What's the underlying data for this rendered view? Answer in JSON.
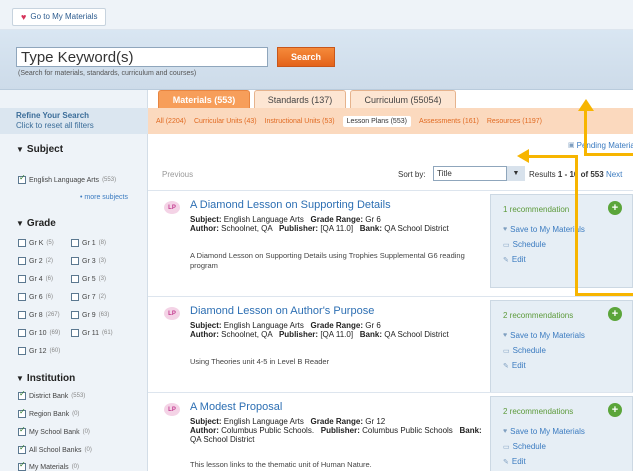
{
  "top": {
    "go_label": "Go to My Materials"
  },
  "search": {
    "value": "Type Keyword(s)",
    "button": "Search",
    "hint": "(Search for materials, standards, curriculum and courses)"
  },
  "refine": {
    "title": "Refine Your Search",
    "reset": "Click to reset all filters"
  },
  "tabs": [
    {
      "label": "Materials (553)"
    },
    {
      "label": "Standards (137)"
    },
    {
      "label": "Curriculum (55054)"
    }
  ],
  "subnav": [
    {
      "label": "All (2204)"
    },
    {
      "label": "Curricular Units (43)"
    },
    {
      "label": "Instructional Units (53)"
    },
    {
      "label": "Lesson Plans (553)"
    },
    {
      "label": "Assessments (161)"
    },
    {
      "label": "Resources (1197)"
    }
  ],
  "facets": {
    "subject": {
      "title": "Subject",
      "items": [
        {
          "label": "English Language Arts",
          "count": "(553)"
        }
      ],
      "more": "• more subjects"
    },
    "grade": {
      "title": "Grade",
      "items": [
        {
          "label": "Gr K",
          "count": "(5)"
        },
        {
          "label": "Gr 1",
          "count": "(8)"
        },
        {
          "label": "Gr 2",
          "count": "(2)"
        },
        {
          "label": "Gr 3",
          "count": "(3)"
        },
        {
          "label": "Gr 4",
          "count": "(6)"
        },
        {
          "label": "Gr 5",
          "count": "(3)"
        },
        {
          "label": "Gr 6",
          "count": "(6)"
        },
        {
          "label": "Gr 7",
          "count": "(2)"
        },
        {
          "label": "Gr 8",
          "count": "(267)"
        },
        {
          "label": "Gr 9",
          "count": "(63)"
        },
        {
          "label": "Gr 10",
          "count": "(69)"
        },
        {
          "label": "Gr 11",
          "count": "(61)"
        },
        {
          "label": "Gr 12",
          "count": "(60)"
        }
      ]
    },
    "institution": {
      "title": "Institution",
      "items": [
        {
          "label": "District Bank",
          "count": "(553)"
        },
        {
          "label": "Region Bank",
          "count": "(0)"
        },
        {
          "label": "My School Bank",
          "count": "(0)"
        },
        {
          "label": "All School Banks",
          "count": "(0)"
        },
        {
          "label": "My Materials",
          "count": "(0)"
        }
      ]
    }
  },
  "toolbar": {
    "pending": "Pending Materials",
    "previous": "Previous",
    "sortby": "Sort by:",
    "sort_value": "Title",
    "results_prefix": "Results ",
    "results_range": "1 - 10 of 553",
    "next": "Next"
  },
  "labels": {
    "subject": "Subject:",
    "grade_range": "Grade Range:",
    "author": "Author:",
    "publisher": "Publisher:",
    "bank": "Bank:"
  },
  "actions": {
    "save": "Save to My Materials",
    "schedule": "Schedule",
    "edit": "Edit"
  },
  "badge": "LP",
  "results": [
    {
      "title": "A Diamond Lesson on Supporting Details",
      "subject": "English Language Arts",
      "grade": "Gr 6",
      "author": "Schoolnet, QA",
      "publisher": "[QA 11.0]",
      "bank": "QA School District",
      "desc": "A Diamond Lesson on Supporting Details using Trophies Supplemental G6 reading program",
      "recs": "1 recommendation"
    },
    {
      "title": "Diamond Lesson on Author's Purpose",
      "subject": "English Language Arts",
      "grade": "Gr 6",
      "author": "Schoolnet, QA",
      "publisher": "[QA 11.0]",
      "bank": "QA School District",
      "desc": "Using Theories unit 4-5 in Level B Reader",
      "recs": "2 recommendations"
    },
    {
      "title": "A Modest Proposal",
      "subject": "English Language Arts",
      "grade": "Gr 12",
      "author": "Columbus Public Schools.",
      "publisher": "Columbus Public Schools",
      "bank": "QA School District",
      "desc": "This lesson links to the thematic unit of Human Nature.",
      "recs": "2 recommendations"
    }
  ]
}
